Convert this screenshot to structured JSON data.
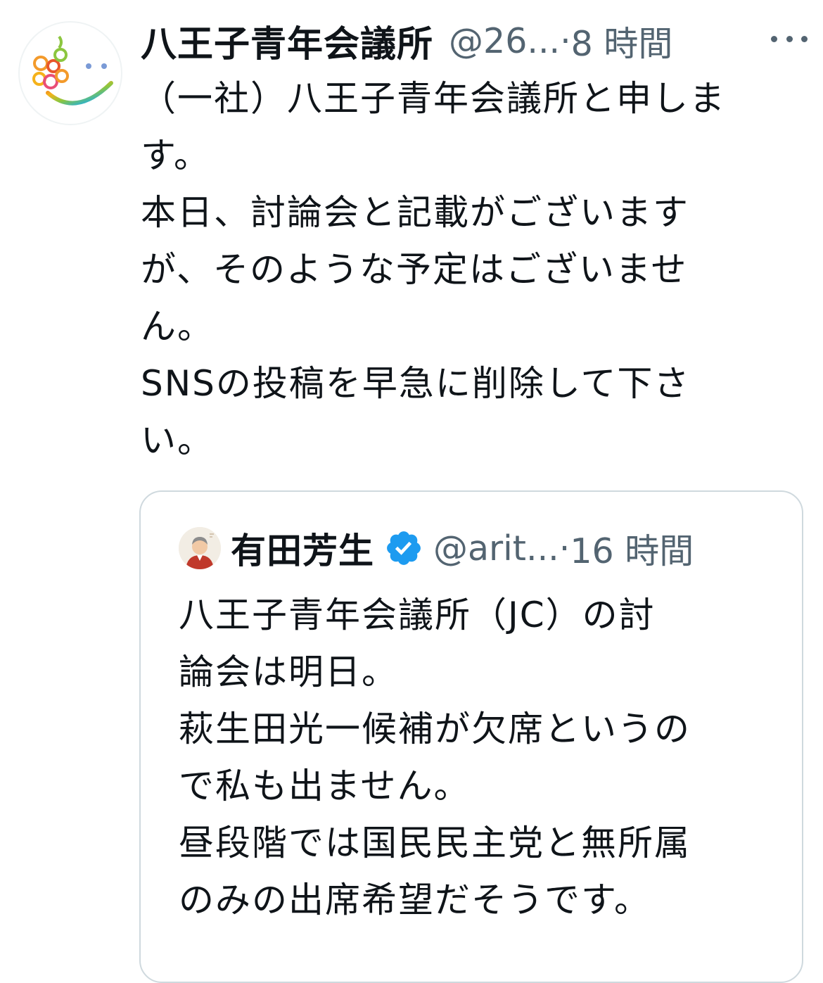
{
  "tweet": {
    "display_name": "八王子青年会議所",
    "handle": "@26...",
    "separator": "·",
    "time": "8 時間",
    "avatar_icon": "smiley-logo-icon",
    "more_icon": "more-options-icon",
    "body_lines": [
      "（一社）八王子青年会議所と申しま",
      "す。",
      "本日、討論会と記載がございます",
      "が、そのような予定はございませ",
      "ん。",
      "SNSの投稿を早急に削除して下さ",
      "い。"
    ]
  },
  "quoted_tweet": {
    "display_name": "有田芳生",
    "verified_icon": "verified-badge-icon",
    "handle": "@arit...",
    "separator": "·",
    "time": "16 時間",
    "avatar_icon": "user-avatar-icon",
    "body_lines": [
      "八王子青年会議所（JC）の討",
      "論会は明日。",
      "萩生田光一候補が欠席というの",
      "で私も出ません。",
      "昼段階では国民民主党と無所属",
      "のみの出席希望だそうです。"
    ]
  },
  "colors": {
    "text_primary": "#0f1419",
    "text_secondary": "#536471",
    "border": "#cfd9de",
    "verified": "#1d9bf0"
  }
}
